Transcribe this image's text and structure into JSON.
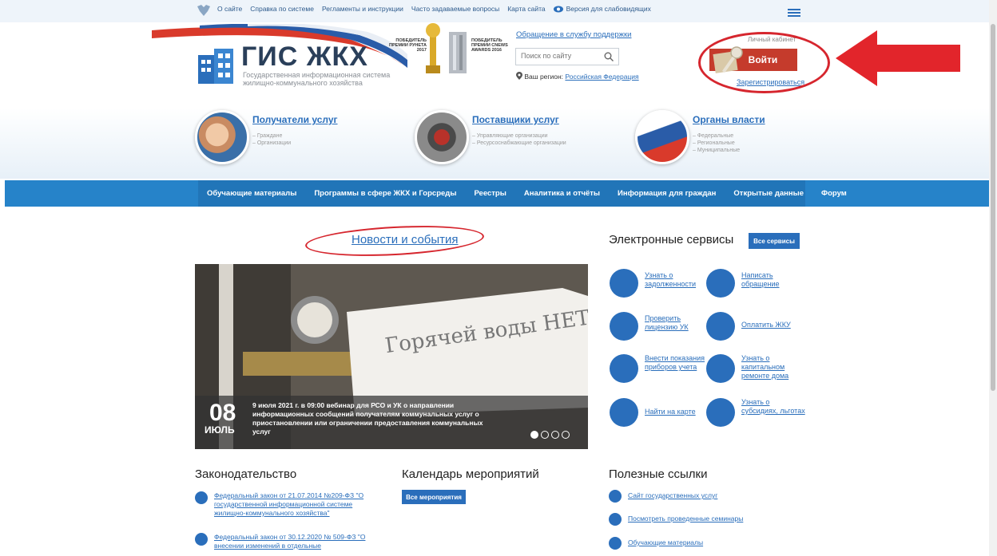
{
  "topbar": {
    "links": [
      "О сайте",
      "Справка по системе",
      "Регламенты и инструкции",
      "Часто задаваемые вопросы",
      "Карта сайта"
    ],
    "accessibility": "Версия для слабовидящих"
  },
  "logo": {
    "title": "ГИС ЖКХ",
    "subtitle": "Государственная информационная система жилищно-коммунального хозяйства"
  },
  "awards": {
    "runet": "ПОБЕДИТЕЛЬ ПРЕМИИ РУНЕТА 2017",
    "cnews": "ПОБЕДИТЕЛЬ ПРЕМИИ CNEWS AWARDS 2016"
  },
  "header": {
    "support_link": "Обращение в службу поддержки",
    "search_placeholder": "Поиск по сайту",
    "region_label": "Ваш регион:",
    "region_value": "Российская Федерация",
    "cabinet_label": "Личный кабинет",
    "login": "Войти",
    "register": "Зарегистрироваться"
  },
  "audiences": [
    {
      "title": "Получатели услуг",
      "items": [
        "– Граждане",
        "– Организации"
      ]
    },
    {
      "title": "Поставщики услуг",
      "items": [
        "– Управляющие организации",
        "– Ресурсоснабжающие организации"
      ]
    },
    {
      "title": "Органы власти",
      "items": [
        "– Федеральные",
        "– Региональные",
        "– Муниципальные"
      ]
    }
  ],
  "nav": [
    "Обучающие материалы",
    "Программы в сфере ЖКХ и Горсреды",
    "Реестры",
    "Аналитика и отчёты",
    "Информация для граждан",
    "Открытые данные",
    "Форум"
  ],
  "news": {
    "title": "Новости и события",
    "day": "08",
    "month": "ИЮЛЬ",
    "caption": "9 июля 2021 г. в 09:00 вебинар для РСО и УК о направлении информационных сообщений получателям коммунальных услуг о приостановлении или ограничении предоставления коммунальных услуг",
    "sign_text": "Горячей воды НЕТ!!!"
  },
  "services": {
    "title": "Электронные сервисы",
    "all_button": "Все сервисы",
    "items": [
      "Узнать о задолженности",
      "Написать обращение",
      "Проверить лицензию УК",
      "Оплатить ЖКУ",
      "Внести показания приборов учета",
      "Узнать о капитальном ремонте дома",
      "Найти на карте",
      "Узнать о субсидиях, льготах"
    ]
  },
  "legislation": {
    "title": "Законодательство",
    "items": [
      "Федеральный закон от 21.07.2014 №209-ФЗ \"О государственной информационной системе жилищно-коммунального хозяйства\"",
      "Федеральный закон от 30.12.2020 № 509-ФЗ \"О внесении изменений в отдельные"
    ]
  },
  "calendar": {
    "title": "Календарь мероприятий",
    "button": "Все мероприятия"
  },
  "useful": {
    "title": "Полезные ссылки",
    "items": [
      "Сайт государственных услуг",
      "Посмотреть проведенные семинары",
      "Обучающие материалы"
    ]
  },
  "colors": {
    "brand_blue": "#2a6ebb",
    "nav_blue": "#2683c9",
    "login_red": "#c53b2c",
    "annotation_red": "#d6262e"
  }
}
